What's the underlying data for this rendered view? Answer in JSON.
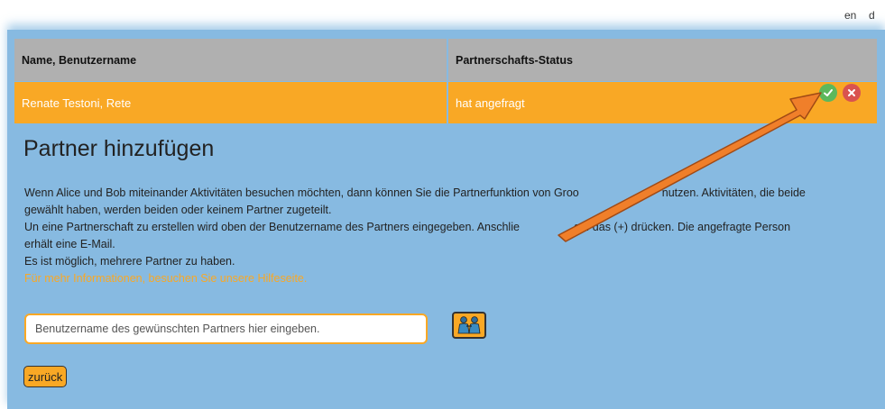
{
  "language_switcher": {
    "en": "en",
    "de": "d"
  },
  "partners_table": {
    "headers": [
      "Name, Benutzername",
      "Partnerschafts-Status"
    ],
    "rows": [
      {
        "name": "Renate Testoni, Rete",
        "status": "hat angefragt"
      }
    ],
    "actions": {
      "accept_icon": "check-icon",
      "reject_icon": "close-icon"
    }
  },
  "add_partner": {
    "title": "Partner hinzufügen",
    "paragraphs": [
      "Wenn Alice und Bob miteinander Aktivitäten besuchen möchten, dann können Sie die Partnerfunktion von Groo",
      "nutzen. Aktivitäten, die beide gewählt haben, werden beiden oder keinem Partner zugeteilt.",
      "Un eine Partnerschaft zu erstellen wird oben der Benutzername des Partners eingegeben. Anschlie",
      "auf das (+) drücken. Die angefragte Person erhält eine E-Mail.",
      "Es ist möglich, mehrere Partner zu haben."
    ],
    "help_link": "Für mehr Informationen, besuchen Sie unsere Hilfeseite.",
    "input_placeholder": "Benutzername des gewünschten Partners hier eingeben.",
    "add_button_icon": "partner-add-icon",
    "back_button": "zurück"
  },
  "colors": {
    "panel_bg": "#87BAE1",
    "header_bg": "#b0b0b0",
    "row_bg": "#F9A825",
    "accept": "#5cb85c",
    "reject": "#d9534f",
    "annotation_arrow": "#F07F2A"
  }
}
